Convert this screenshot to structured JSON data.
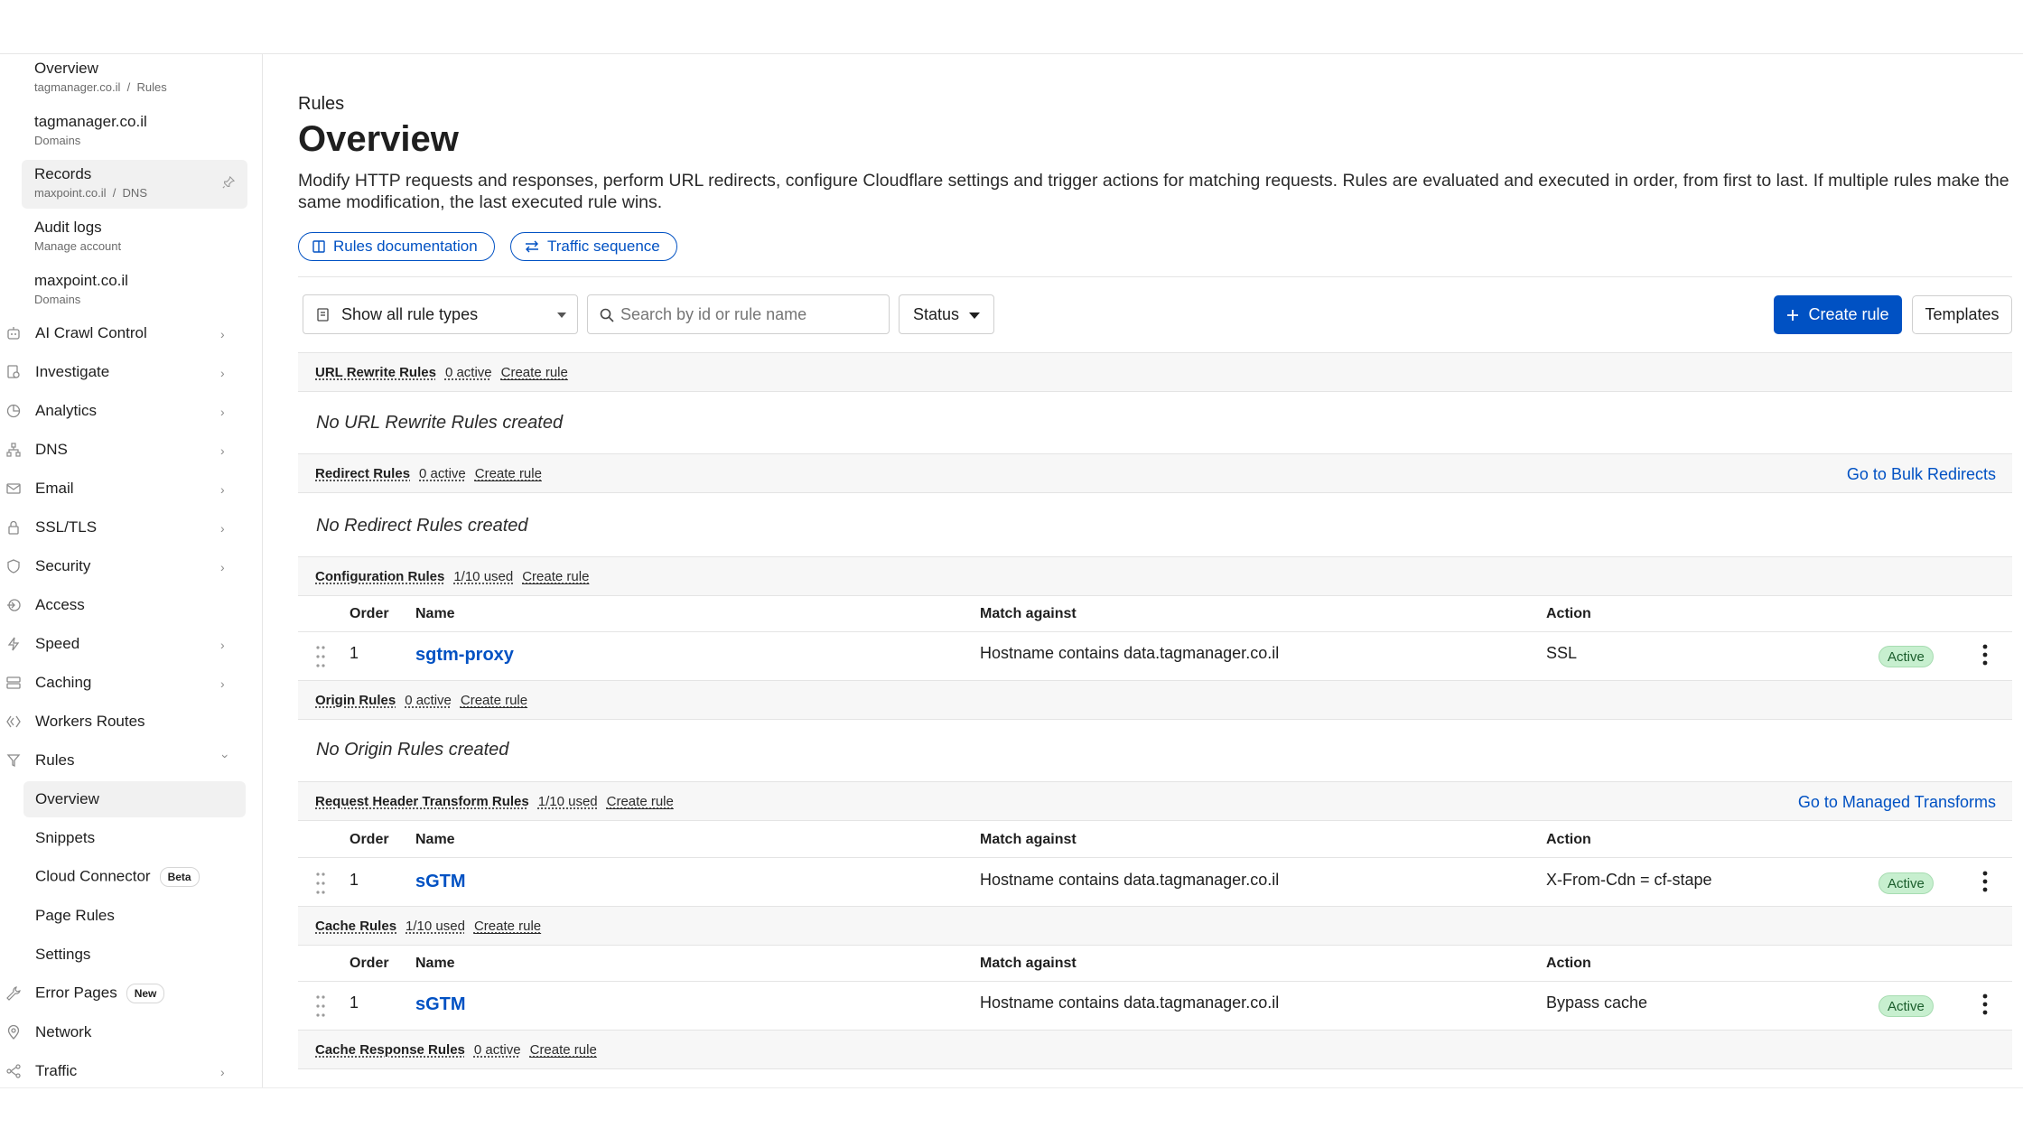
{
  "recent": [
    {
      "title": "Overview",
      "sub1": "tagmanager.co.il",
      "sub2": "Rules"
    },
    {
      "title": "tagmanager.co.il",
      "sub1": "Domains"
    },
    {
      "title": "Records",
      "sub1": "maxpoint.co.il",
      "sub2": "DNS"
    },
    {
      "title": "Audit logs",
      "sub1": "Manage account"
    },
    {
      "title": "maxpoint.co.il",
      "sub1": "Domains"
    }
  ],
  "nav": {
    "ai_crawl": "AI Crawl Control",
    "investigate": "Investigate",
    "analytics": "Analytics",
    "dns": "DNS",
    "email": "Email",
    "ssl": "SSL/TLS",
    "security": "Security",
    "access": "Access",
    "speed": "Speed",
    "caching": "Caching",
    "workers": "Workers Routes",
    "rules": "Rules",
    "rules_sub": [
      "Overview",
      "Snippets",
      "Cloud Connector",
      "Page Rules",
      "Settings"
    ],
    "cloud_badge": "Beta",
    "error_pages": "Error Pages",
    "error_badge": "New",
    "network": "Network",
    "traffic": "Traffic"
  },
  "page": {
    "breadcrumb": "Rules",
    "title": "Overview",
    "description": "Modify HTTP requests and responses, perform URL redirects, configure Cloudflare settings and trigger actions for matching requests. Rules are evaluated and executed in order, from first to last. If multiple rules make the same modification, the last executed rule wins.",
    "docs_link": "Rules documentation",
    "traffic_link": "Traffic sequence"
  },
  "toolbar": {
    "filter_value": "Show all rule types",
    "search_placeholder": "Search by id or rule name",
    "status_label": "Status",
    "create_label": "Create rule",
    "templates_label": "Templates"
  },
  "columns": {
    "order": "Order",
    "name": "Name",
    "match": "Match against",
    "action": "Action"
  },
  "create_rule": "Create rule",
  "sections": {
    "url_rewrite": {
      "title": "URL Rewrite Rules",
      "count": "0 active",
      "empty": "No URL Rewrite Rules created"
    },
    "redirect": {
      "title": "Redirect Rules",
      "count": "0 active",
      "empty": "No Redirect Rules created",
      "link": "Go to Bulk Redirects"
    },
    "config": {
      "title": "Configuration Rules",
      "count": "1/10 used",
      "rows": [
        {
          "order": "1",
          "name": "sgtm-proxy",
          "match": "Hostname contains data.tagmanager.co.il",
          "action": "SSL",
          "status": "Active"
        }
      ]
    },
    "origin": {
      "title": "Origin Rules",
      "count": "0 active",
      "empty": "No Origin Rules created"
    },
    "req_header": {
      "title": "Request Header Transform Rules",
      "count": "1/10 used",
      "link": "Go to Managed Transforms",
      "rows": [
        {
          "order": "1",
          "name": "sGTM",
          "match": "Hostname contains data.tagmanager.co.il",
          "action": "X-From-Cdn = cf-stape",
          "status": "Active"
        }
      ]
    },
    "cache": {
      "title": "Cache Rules",
      "count": "1/10 used",
      "rows": [
        {
          "order": "1",
          "name": "sGTM",
          "match": "Hostname contains data.tagmanager.co.il",
          "action": "Bypass cache",
          "status": "Active"
        }
      ]
    },
    "cache_resp": {
      "title": "Cache Response Rules",
      "count": "0 active"
    }
  }
}
